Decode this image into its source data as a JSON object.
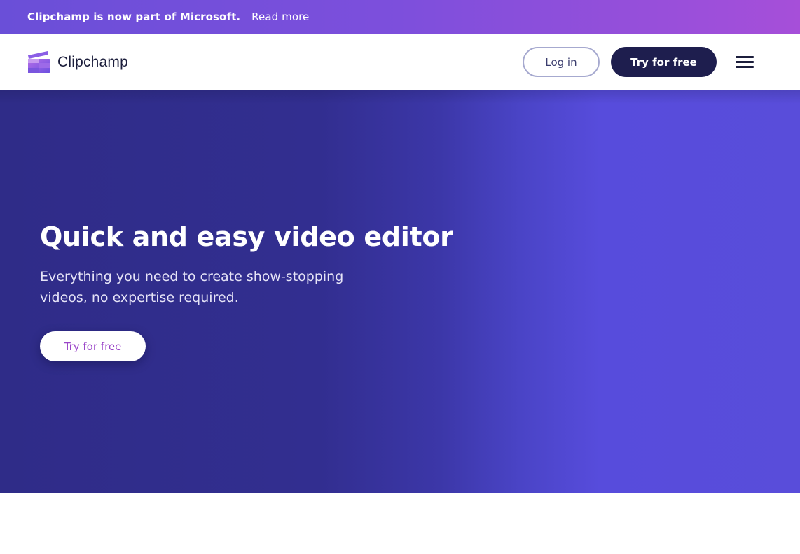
{
  "announcement": {
    "text": "Clipchamp is now part of Microsoft.",
    "link_label": "Read more"
  },
  "header": {
    "logo_text": "Clipchamp",
    "login_label": "Log in",
    "try_label": "Try for free",
    "menu_icon": "hamburger-menu-icon"
  },
  "hero": {
    "title": "Quick and easy video editor",
    "subtitle": "Everything you need to create show-stopping videos, no expertise required.",
    "cta_label": "Try for free"
  },
  "colors": {
    "announcement_gradient_start": "#6a4fd8",
    "announcement_gradient_end": "#a64fd9",
    "brand_dark": "#1e1e4e",
    "hero_left": "#2f2c88",
    "hero_right": "#594dda",
    "cta_text": "#9a45c8"
  }
}
